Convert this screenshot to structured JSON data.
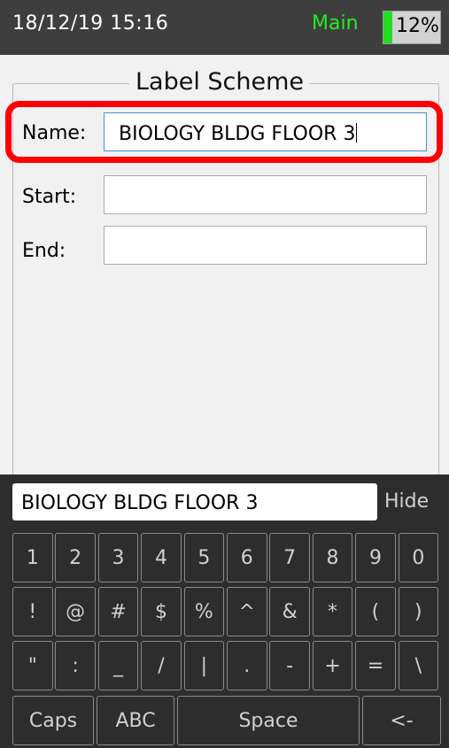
{
  "status_bar": {
    "datetime": "18/12/19 15:16",
    "power_source": "Main",
    "battery_text": "12%",
    "battery_level": 0.12
  },
  "form": {
    "title": "Label Scheme",
    "fields": [
      {
        "label": "Name:",
        "value": "BIOLOGY BLDG FLOOR 3"
      },
      {
        "label": "Start:",
        "value": ""
      },
      {
        "label": "End:",
        "value": ""
      }
    ]
  },
  "keyboard": {
    "preview_text": "BIOLOGY BLDG FLOOR 3",
    "hide_label": "Hide",
    "rows": [
      [
        "1",
        "2",
        "3",
        "4",
        "5",
        "6",
        "7",
        "8",
        "9",
        "0"
      ],
      [
        "!",
        "@",
        "#",
        "$",
        "%",
        "^",
        "&",
        "*",
        "(",
        ")"
      ],
      [
        "\"",
        ":",
        "_",
        "/",
        "|",
        ".",
        "-",
        "+",
        "=",
        "\\"
      ]
    ],
    "bottom_row": {
      "caps": "Caps",
      "abc": "ABC",
      "space": "Space",
      "backspace": "<-"
    }
  },
  "colors": {
    "status_bar_bg": "#3e3e3e",
    "power_source": "#22ee22",
    "battery_fill": "#22dd22",
    "highlight": "#ff0000",
    "keyboard_bg": "#2d2d2d"
  }
}
